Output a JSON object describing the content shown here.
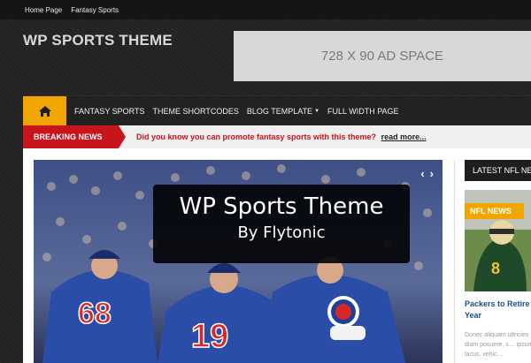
{
  "topbar": {
    "links": [
      "Home Page",
      "Fantasy Sports"
    ]
  },
  "site": {
    "logo": "WP SPORTS THEME"
  },
  "ad": {
    "label": "728 X 90 AD SPACE"
  },
  "nav": {
    "home_icon": "home-icon",
    "items": [
      "FANTASY SPORTS",
      "THEME SHORTCODES",
      "BLOG TEMPLATE",
      "FULL WIDTH PAGE"
    ]
  },
  "breaking": {
    "label": "BREAKING NEWS",
    "text": "Did you know you can promote fantasy sports with this theme?",
    "link": "read more..."
  },
  "slider": {
    "caption_title": "WP Sports Theme",
    "caption_subtitle": "By Flytonic",
    "prev_icon": "chevron-left-icon",
    "next_icon": "chevron-right-icon",
    "jersey_numbers": [
      "68",
      "19"
    ]
  },
  "sidebar": {
    "title": "LATEST NFL NEWS",
    "badge": "NFL NEWS",
    "headline": "Packers to Retire Year",
    "excerpt": "Donec aliquam ultricies diam posuere, s… ipsum lacus, vehic…"
  },
  "colors": {
    "accent": "#f0a500",
    "breaking": "#c8141b",
    "link": "#1a4f8f"
  }
}
